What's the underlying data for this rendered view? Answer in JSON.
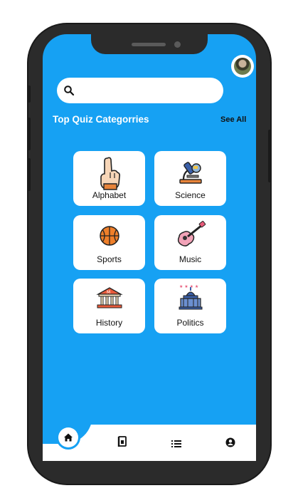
{
  "header": {
    "avatar_name": "avatar"
  },
  "search": {
    "placeholder": "",
    "value": ""
  },
  "section": {
    "title": "Top Quiz Categorries",
    "see_all": "See All"
  },
  "categories": [
    {
      "label": "Alphabet",
      "icon": "hand-one-finger-icon"
    },
    {
      "label": "Science",
      "icon": "microscope-icon"
    },
    {
      "label": "Sports",
      "icon": "basketball-icon"
    },
    {
      "label": "Music",
      "icon": "guitar-icon"
    },
    {
      "label": "History",
      "icon": "museum-icon"
    },
    {
      "label": "Politics",
      "icon": "capitol-icon"
    }
  ],
  "bottom_nav": [
    {
      "icon": "home-icon",
      "active": true
    },
    {
      "icon": "book-icon",
      "active": false
    },
    {
      "icon": "list-icon",
      "active": false
    },
    {
      "icon": "account-icon",
      "active": false
    }
  ],
  "colors": {
    "accent": "#16a1f3",
    "card": "#ffffff",
    "frame": "#2b2b2b"
  }
}
